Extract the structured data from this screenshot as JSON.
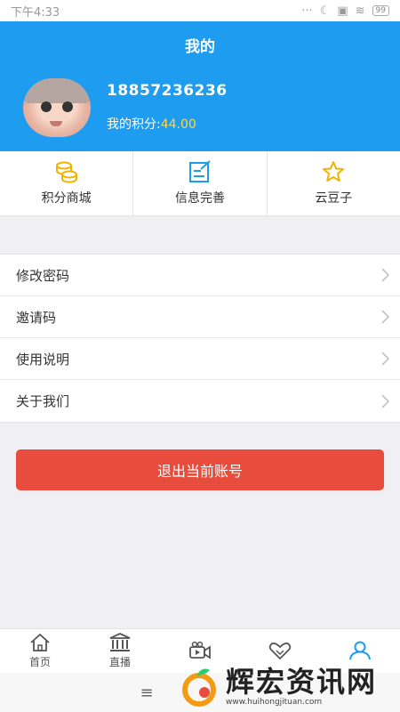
{
  "status_bar": {
    "time": "下午4:33",
    "battery": "99"
  },
  "header": {
    "title": "我的",
    "phone": "18857236236",
    "points_label": "我的积分:",
    "points_value": "44.00",
    "accent_color": "#1e9cf0"
  },
  "quick_actions": [
    {
      "label": "积分商城",
      "icon": "coins-icon"
    },
    {
      "label": "信息完善",
      "icon": "edit-icon"
    },
    {
      "label": "云豆子",
      "icon": "star-icon"
    }
  ],
  "menu": [
    {
      "label": "修改密码"
    },
    {
      "label": "邀请码"
    },
    {
      "label": "使用说明"
    },
    {
      "label": "关于我们"
    }
  ],
  "logout_label": "退出当前账号",
  "logout_color": "#e74c3c",
  "tabs": [
    {
      "label": "首页",
      "icon": "home-icon"
    },
    {
      "label": "直播",
      "icon": "bank-icon"
    },
    {
      "label": "",
      "icon": "video-icon"
    },
    {
      "label": "",
      "icon": "handshake-icon"
    },
    {
      "label": "",
      "icon": "user-icon"
    }
  ],
  "watermark": {
    "text": "辉宏资讯网",
    "url": "www.huihongjituan.com"
  }
}
